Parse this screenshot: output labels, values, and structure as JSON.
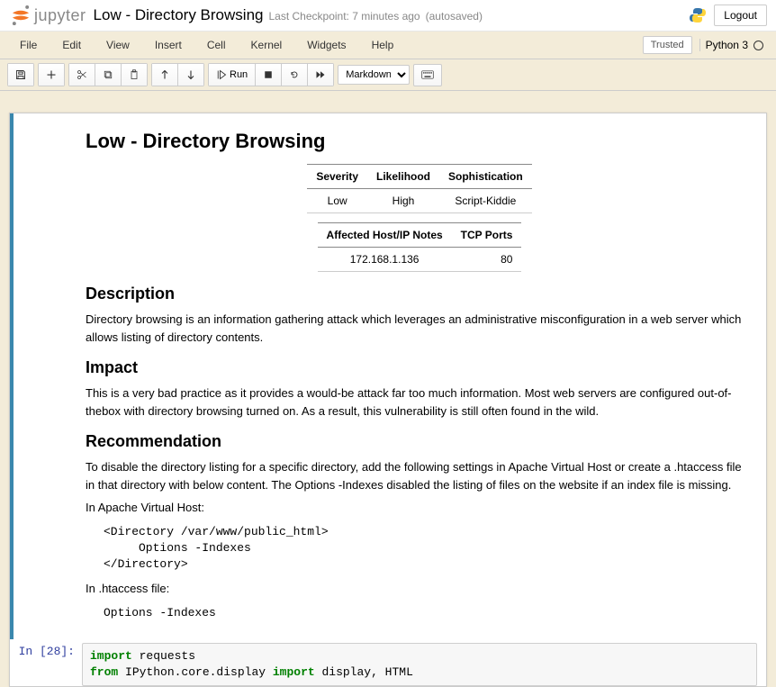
{
  "header": {
    "brand": "jupyter",
    "notebook_name": "Low - Directory Browsing",
    "checkpoint": "Last Checkpoint: 7 minutes ago",
    "autosave": "(autosaved)",
    "logout": "Logout"
  },
  "menu": {
    "items": [
      "File",
      "Edit",
      "View",
      "Insert",
      "Cell",
      "Kernel",
      "Widgets",
      "Help"
    ],
    "trusted": "Trusted",
    "kernel": "Python 3"
  },
  "toolbar": {
    "run_label": "Run",
    "cell_type": "Markdown"
  },
  "markdown": {
    "title": "Low - Directory Browsing",
    "table1": {
      "headers": [
        "Severity",
        "Likelihood",
        "Sophistication"
      ],
      "row": [
        "Low",
        "High",
        "Script-Kiddie"
      ]
    },
    "table2": {
      "headers": [
        "Affected Host/IP Notes",
        "TCP Ports"
      ],
      "row": [
        "172.168.1.136",
        "80"
      ]
    },
    "desc_h": "Description",
    "desc_p": "Directory browsing is an information gathering attack which leverages an administrative misconfiguration in a web server which allows listing of directory contents.",
    "impact_h": "Impact",
    "impact_p": "This is a very bad practice as it provides a would-be attack far too much information. Most web servers are configured out-of-thebox with directory browsing turned on. As a result, this vulnerability is still often found in the wild.",
    "rec_h": "Recommendation",
    "rec_p": "To disable the directory listing for a specific directory, add the following settings in Apache Virtual Host or create a .htaccess file in that directory with below content. The Options -Indexes disabled the listing of files on the website if an index file is missing.",
    "apache_label": "In Apache Virtual Host:",
    "apache_code": "<Directory /var/www/public_html>\n     Options -Indexes\n</Directory>",
    "htaccess_label": "In .htaccess file:",
    "htaccess_code": "Options -Indexes"
  },
  "code": {
    "prompt": "In [28]:",
    "line1_kw": "import",
    "line1_rest": " requests",
    "line2_kw1": "from",
    "line2_mid": " IPython.core.display ",
    "line2_kw2": "import",
    "line2_rest": " display, HTML"
  }
}
